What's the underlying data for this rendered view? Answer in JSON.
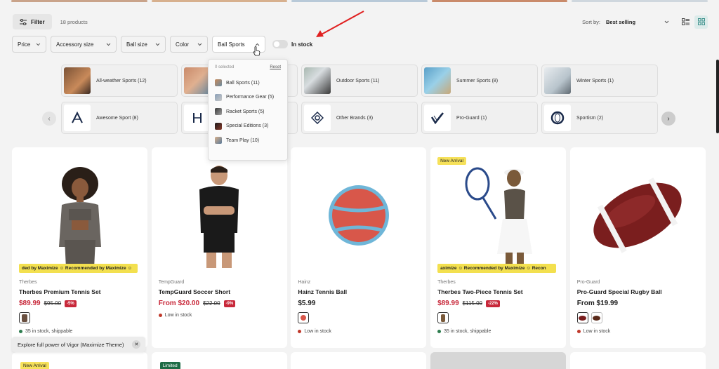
{
  "toolbar": {
    "filter_label": "Filter",
    "product_count": "18 products",
    "sort_label": "Sort by:",
    "sort_value": "Best selling"
  },
  "filters": [
    {
      "label": "Price"
    },
    {
      "label": "Accessory size"
    },
    {
      "label": "Ball size"
    },
    {
      "label": "Color"
    },
    {
      "label": "Ball Sports"
    }
  ],
  "in_stock_label": "In stock",
  "dropdown": {
    "selected_text": "0 selected",
    "reset_label": "Reset",
    "options": [
      {
        "label": "Ball Sports (11)"
      },
      {
        "label": "Performance Gear (5)"
      },
      {
        "label": "Racket Sports (5)"
      },
      {
        "label": "Special Editions (3)"
      },
      {
        "label": "Team Play (10)"
      }
    ]
  },
  "categories": [
    {
      "label": "All-weather Sports (12)"
    },
    {
      "label": ""
    },
    {
      "label": "Outdoor Sports (11)"
    },
    {
      "label": "Summer Sports (8)"
    },
    {
      "label": "Winter Sports (1)"
    }
  ],
  "brands": [
    {
      "label": "Awesome Sport (8)"
    },
    {
      "label": ""
    },
    {
      "label": "Other Brands (3)"
    },
    {
      "label": "Pro-Guard (1)"
    },
    {
      "label": "Sportism (2)"
    }
  ],
  "products": [
    {
      "brand": "Therbes",
      "name": "Therbes Premium Tennis Set",
      "price": "$89.99",
      "old_price": "$95.00",
      "discount": "-5%",
      "badge": "",
      "rec_strip": "ded by Maximize  ☺  Recommended by Maximize  ☺",
      "stock": "35 in stock, shippable"
    },
    {
      "brand": "TempGuard",
      "name": "TempGuard Soccer Short",
      "price": "From $20.00",
      "old_price": "$22.00",
      "discount": "-9%",
      "badge": "",
      "rec_strip": "",
      "stock": "Low in stock"
    },
    {
      "brand": "Hainz",
      "name": "Hainz Tennis Ball",
      "price": "$5.99",
      "old_price": "",
      "discount": "",
      "badge": "",
      "rec_strip": "",
      "stock": "Low in stock"
    },
    {
      "brand": "Therbes",
      "name": "Therbes Two-Piece Tennis Set",
      "price": "$89.99",
      "old_price": "$115.00",
      "discount": "-22%",
      "badge": "New Arrival",
      "rec_strip": "aximize  ☺  Recommended by Maximize  ☺  Recon",
      "stock": "35 in stock, shippable"
    },
    {
      "brand": "Pro-Guard",
      "name": "Pro-Guard Special Rugby Ball",
      "price": "From $19.99",
      "old_price": "",
      "discount": "",
      "badge": "",
      "rec_strip": "",
      "stock": "Low in stock"
    }
  ],
  "row2_badges": [
    "New Arrival",
    "Limited",
    "",
    "",
    ""
  ],
  "toast": {
    "text": "Explore full power of Vigor (Maximize Theme)",
    "close": "✕"
  },
  "colors": {
    "sale": "#c8283a",
    "accent": "#3a8f8a",
    "badge": "#f6e15a",
    "low_stock": "#c0392b",
    "in_stock": "#2e7d4f",
    "arrow": "#e02020"
  }
}
